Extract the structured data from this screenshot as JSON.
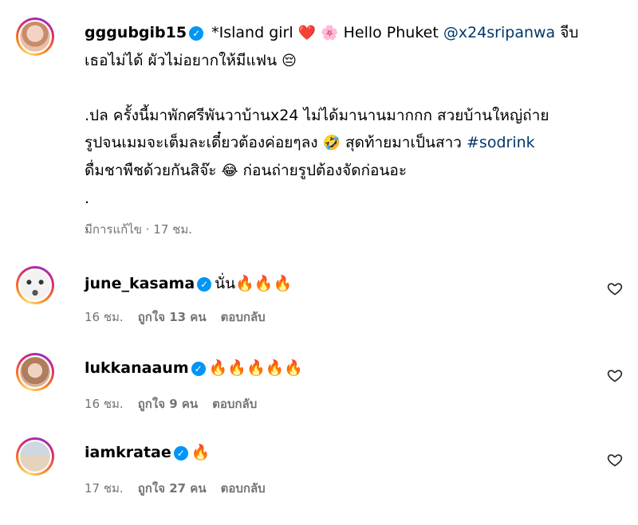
{
  "post": {
    "username": "gggubgib15",
    "caption_lines": [
      {
        "pre": " *Island girl ",
        "emoji1": "❤️",
        "emoji2": "🌸",
        "mid": " Hello Phuket ",
        "mention": "@x24sripanwa",
        "post": " จีบ"
      },
      {
        "text": "เธอไม่ได้ ผัวไม่อยากให้มีแฟน ",
        "emoji": "😔"
      },
      {
        "text": ""
      },
      {
        "text": ".ปล ครั้งนี้มาพักศรีพันวาบ้านx24 ไม่ได้มานานมากกก สวยบ้านใหญ่ถ่าย"
      },
      {
        "pre": "รูปจนเมมจะเต็มละเดี๋ยวต้องค่อยๆลง ",
        "emoji": "🤣",
        "mid": " สุดท้ายมาเป็นสาว ",
        "hashtag": "#sodrink"
      },
      {
        "pre": "ดื่มชาพืชด้วยกันสิจ๊ะ ",
        "emoji": "😂",
        "post": " ก่อนถ่ายรูปต้องจัดก่อนอะ"
      },
      {
        "text": "."
      },
      {
        "text": "."
      }
    ],
    "edited_label": "มีการแก้ไข · 17 ชม."
  },
  "comments": [
    {
      "username": "june_kasama",
      "text": "นั่น",
      "fires": "🔥🔥🔥",
      "time": "16 ชม.",
      "likes": "ถูกใจ 13 คน",
      "reply": "ตอบกลับ"
    },
    {
      "username": "lukkanaaum",
      "text": "",
      "fires": "🔥🔥🔥🔥🔥",
      "time": "16 ชม.",
      "likes": "ถูกใจ 9 คน",
      "reply": "ตอบกลับ"
    },
    {
      "username": "iamkratae",
      "text": "",
      "fires": "🔥",
      "time": "17 ชม.",
      "likes": "ถูกใจ 27 คน",
      "reply": "ตอบกลับ"
    }
  ],
  "icons": {
    "verified": "verified-badge-icon",
    "like": "heart-outline-icon"
  },
  "colors": {
    "link": "#00376b",
    "verified": "#0095f6",
    "meta": "#737373"
  }
}
